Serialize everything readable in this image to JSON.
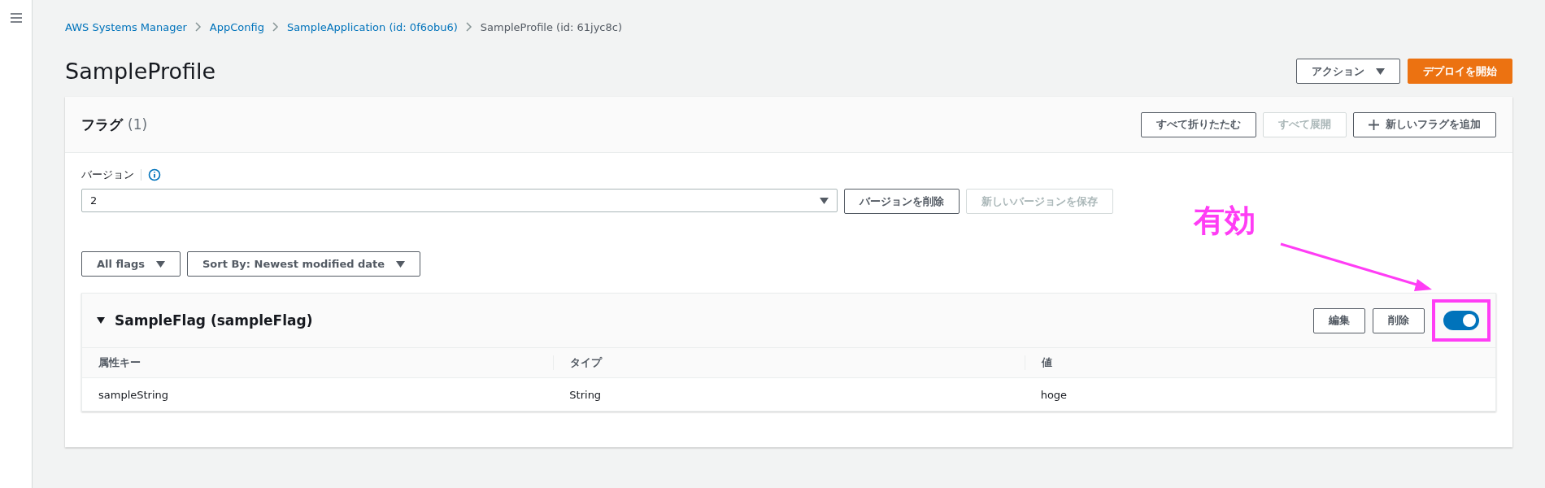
{
  "breadcrumbs": [
    {
      "label": "AWS Systems Manager",
      "link": true
    },
    {
      "label": "AppConfig",
      "link": true
    },
    {
      "label": "SampleApplication (id: 0f6obu6)",
      "link": true
    },
    {
      "label": "SampleProfile (id: 61jyc8c)",
      "link": false
    }
  ],
  "page_title": "SampleProfile",
  "header_buttons": [
    {
      "label": "アクション",
      "kind": "dropdown"
    },
    {
      "label": "デプロイを開始",
      "kind": "primary"
    }
  ],
  "panel": {
    "title": "フラグ",
    "count": "(1)",
    "buttons": [
      {
        "label": "すべて折りたたむ",
        "disabled": false,
        "kind": "plain"
      },
      {
        "label": "すべて展開",
        "disabled": true,
        "kind": "plain"
      },
      {
        "label": "新しいフラグを追加",
        "disabled": false,
        "kind": "add"
      }
    ],
    "version": {
      "label": "バージョン",
      "value": "2",
      "buttons": [
        {
          "label": "バージョンを削除",
          "disabled": false
        },
        {
          "label": "新しいバージョンを保存",
          "disabled": true
        }
      ]
    },
    "filters": [
      "All flags",
      "Sort By: Newest modified date"
    ],
    "flags": [
      {
        "title": "SampleFlag (sampleFlag)",
        "expanded": true,
        "enabled": true,
        "buttons": [
          "編集",
          "削除"
        ],
        "columns": [
          "属性キー",
          "タイプ",
          "値"
        ],
        "rows": [
          [
            "sampleString",
            "String",
            "hoge"
          ]
        ]
      }
    ]
  },
  "annotation": {
    "label": "有効"
  }
}
